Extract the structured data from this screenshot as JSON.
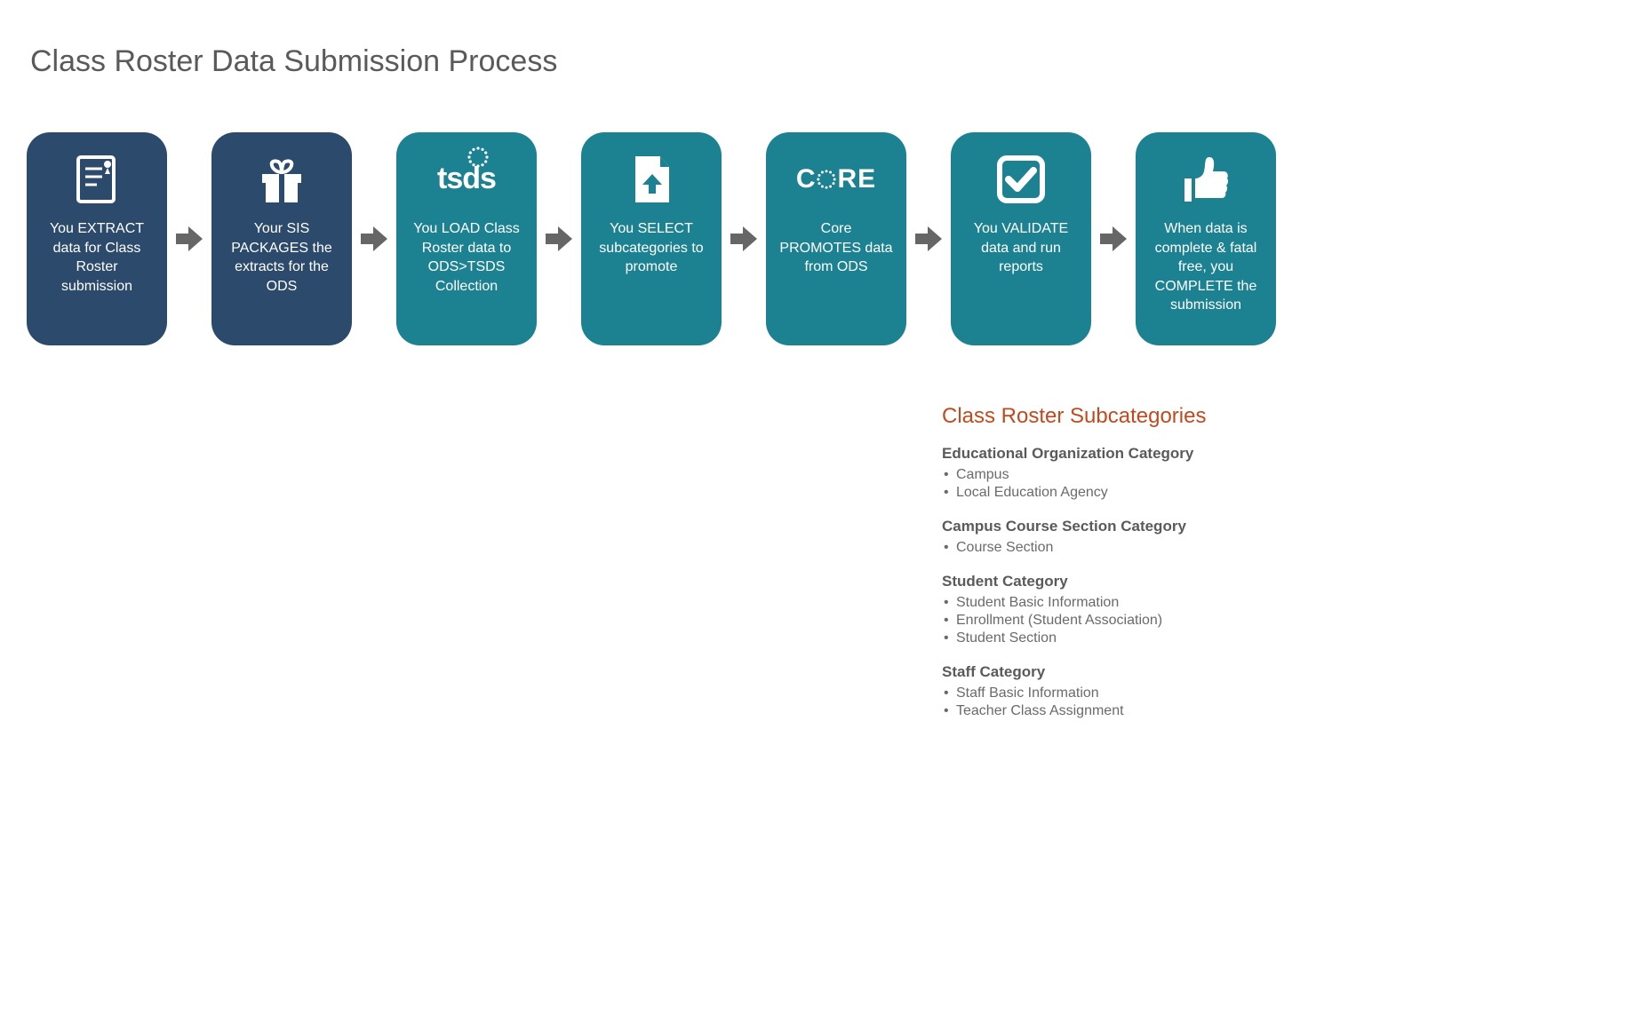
{
  "title": "Class Roster Data Submission Process",
  "steps": [
    {
      "color": "navy",
      "icon": "document-icon",
      "text": "You EXTRACT data for Class Roster submission"
    },
    {
      "color": "navy",
      "icon": "gift-icon",
      "text": "Your SIS PACKAGES the extracts for the ODS"
    },
    {
      "color": "teal",
      "icon": "tsds-logo-icon",
      "text": "You LOAD Class Roster data to ODS>TSDS Collection"
    },
    {
      "color": "teal",
      "icon": "upload-icon",
      "text": "You SELECT subcategories to promote"
    },
    {
      "color": "teal",
      "icon": "core-logo-icon",
      "text": "Core PROMOTES data from ODS"
    },
    {
      "color": "teal",
      "icon": "checkbox-icon",
      "text": "You VALIDATE data and run reports"
    },
    {
      "color": "teal",
      "icon": "thumbs-up-icon",
      "text": "When data is complete & fatal free, you COMPLETE the submission"
    }
  ],
  "sidebar": {
    "heading": "Class Roster  Subcategories",
    "categories": [
      {
        "title": "Educational Organization Category",
        "items": [
          "Campus",
          "Local Education Agency"
        ]
      },
      {
        "title": "Campus Course Section Category",
        "items": [
          "Course Section"
        ]
      },
      {
        "title": "Student Category",
        "items": [
          "Student Basic Information",
          "Enrollment (Student Association)",
          "Student Section"
        ]
      },
      {
        "title": "Staff Category",
        "items": [
          "Staff Basic Information",
          "Teacher Class Assignment"
        ]
      }
    ]
  }
}
